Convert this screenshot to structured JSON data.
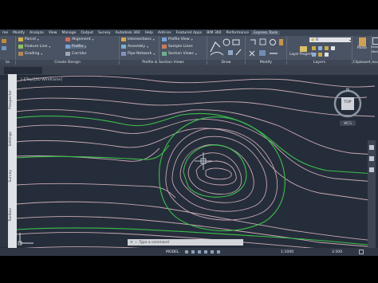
{
  "menu": [
    "Modify",
    "Analyze",
    "View",
    "Manage",
    "Output",
    "Survey",
    "Autodesk 360",
    "Help",
    "Add-ins",
    "Featured Apps",
    "BIM 360",
    "Performance",
    "Express Tools"
  ],
  "menu_left_partial": "me",
  "ribbon": {
    "col1": [
      "Parcel",
      "Feature Line",
      "Grading"
    ],
    "col2": [
      "Alignment",
      "Profile",
      "Corridor"
    ],
    "col3": [
      "Intersections",
      "Assembly",
      "Pipe Network"
    ],
    "col4": [
      "Profile View",
      "Sample Lines",
      "Section Views"
    ],
    "layer_properties": "Layer Properties",
    "layer_value": "0",
    "paste_label": "Paste",
    "select_mode_label": "Select Mode"
  },
  "panel_titles": [
    "ta",
    "Create Design",
    "Profile & Section Views",
    "Draw",
    "Modify",
    "Layers",
    "Clipboard",
    "Touch"
  ],
  "viewport": {
    "label": "[-][Top][2D Wireframe]",
    "viewcube_face": "TOP",
    "viewcube_compass": "N",
    "wcs_label": "WCS"
  },
  "palette_tabs": [
    "Prospector",
    "Settings",
    "Survey",
    "Toolbox"
  ],
  "command": {
    "placeholder": "Type a command"
  },
  "status": {
    "model": "MODEL",
    "scale": "1:1000",
    "value": "3.500"
  },
  "colors": {
    "background": "#252d3a",
    "contour_major": "#3bbf4a",
    "contour_minor": "#c9a8b4",
    "ribbon": "#4a5363"
  }
}
